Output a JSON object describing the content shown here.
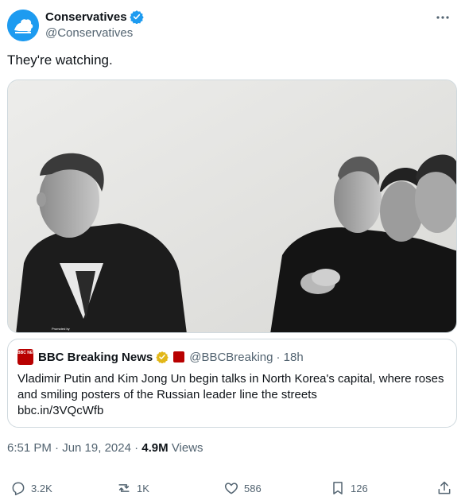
{
  "author": {
    "display_name": "Conservatives",
    "handle": "@Conservatives",
    "brand_color": "#1d9bf0"
  },
  "tweet": {
    "text": "They're watching."
  },
  "image": {
    "description_icon": "photo-collage"
  },
  "quote": {
    "display_name": "BBC Breaking News",
    "avatar_text": "BBC NEWS",
    "handle": "@BBCBreaking",
    "time": "· 18h",
    "text": "Vladimir Putin and Kim Jong Un begin talks in North Korea's capital, where roses and smiling posters of the Russian leader line the streets",
    "link": "bbc.in/3VQcWfb"
  },
  "meta": {
    "time_date": "6:51 PM · Jun 19, 2024 ·",
    "views_count": "4.9M",
    "views_label": "Views"
  },
  "actions": {
    "replies": "3.2K",
    "reposts": "1K",
    "likes": "586",
    "bookmarks": "126"
  }
}
